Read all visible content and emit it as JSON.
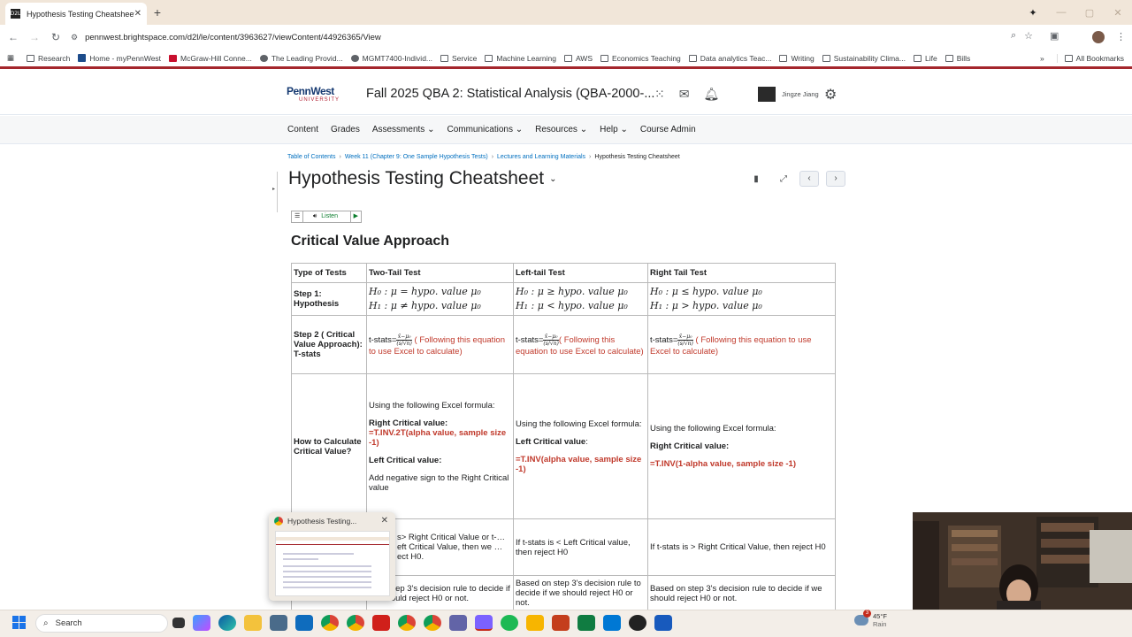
{
  "browser": {
    "tab_title": "Hypothesis Testing Cheatsheet",
    "tab_favicon": "D2L",
    "url": "pennwest.brightspace.com/d2l/le/content/3963627/viewContent/44926365/View",
    "bookmarks": [
      {
        "label": "Research",
        "icon": "folder-icon"
      },
      {
        "label": "Home - myPennWest",
        "icon": "pennwest-icon"
      },
      {
        "label": "McGraw-Hill Conne...",
        "icon": "mcgrawhill-icon"
      },
      {
        "label": "The Leading Provid...",
        "icon": "site-icon"
      },
      {
        "label": "MGMT7400-Individ...",
        "icon": "github-icon"
      },
      {
        "label": "Service",
        "icon": "folder-icon"
      },
      {
        "label": "Machine Learning",
        "icon": "folder-icon"
      },
      {
        "label": "AWS",
        "icon": "folder-icon"
      },
      {
        "label": "Economics Teaching",
        "icon": "folder-icon"
      },
      {
        "label": "Data analytics Teac...",
        "icon": "folder-icon"
      },
      {
        "label": "Writing",
        "icon": "folder-icon"
      },
      {
        "label": "Sustainability Clima...",
        "icon": "folder-icon"
      },
      {
        "label": "Life",
        "icon": "folder-icon"
      },
      {
        "label": "Bills",
        "icon": "folder-icon"
      }
    ],
    "all_bookmarks": "All Bookmarks"
  },
  "header": {
    "logo_main": "PennWest",
    "logo_sub": "UNIVERSITY",
    "course": "Fall 2025 QBA 2: Statistical Analysis (QBA-2000-...",
    "user": "Jingze Jiang"
  },
  "nav": [
    "Content",
    "Grades",
    "Assessments",
    "Communications",
    "Resources",
    "Help",
    "Course Admin"
  ],
  "nav_dropdowns": [
    false,
    false,
    true,
    true,
    true,
    true,
    false
  ],
  "breadcrumbs": [
    "Table of Contents",
    "Week 11 (Chapter 9: One Sample Hypothesis Tests)",
    "Lectures and Learning Materials",
    "Hypothesis Testing Cheatsheet"
  ],
  "page_title": "Hypothesis Testing Cheatsheet",
  "listen": {
    "label": "Listen"
  },
  "section_title": "Critical Value Approach",
  "table": {
    "headers": [
      "Type of Tests",
      "Two-Tail Test",
      "Left-tail Test",
      "Right Tail Test"
    ],
    "step1_label": "Step 1: Hypothesis",
    "h0": [
      "H₀ : μ = hypo. value μ₀",
      "H₀ : μ ≥ hypo. value μ₀",
      "H₀ : μ ≤ hypo. value μ₀"
    ],
    "h1": [
      "H₁ : μ ≠ hypo. value μ₀",
      "H₁ : μ < hypo. value μ₀",
      "H₁ : μ > hypo. value μ₀"
    ],
    "step2_label": "Step 2 ( Critical Value Approach): T-stats",
    "tstat_prefix": "t-stats=",
    "frac_num": "x̄−μ₀",
    "frac_den": "(s/√n)",
    "tstat_note": "( Following this equation to use Excel to calculate)",
    "step3_label": "How to Calculate Critical Value?",
    "excel_intro": "Using the following Excel formula:",
    "right_cv_label": "Right Critical value:",
    "left_cv_label": "Left Critical value:",
    "left_cv_label_b": "Left Critical value",
    "two_tail_right_formula": "=T.INV.2T(alpha value, sample size -1)",
    "two_tail_left_note": "Add negative sign to the Right Critical value",
    "left_tail_formula": "=T.INV(alpha value, sample size -1)",
    "right_tail_formula": "=T.INV(1-alpha value, sample size -1)",
    "rule_two": "s> Right Critical Value or t-…eft Critical Value, then we …ect H0.",
    "rule_left": "If t-stats is < Left Critical value, then reject H0",
    "rule_right": "If t-stats is > Right Critical Value, then reject H0",
    "decide_two": "…on step 3's decision rule to decide if we should reject H0 or not.",
    "decide_left": "Based on step 3's decision rule to decide if we should reject H0 or not.",
    "decide_right": "Based on step 3's decision rule to decide if we should reject H0 or not."
  },
  "popup": {
    "title": "Hypothesis Testing..."
  },
  "taskbar": {
    "search": "Search",
    "weather_temp": "45°F",
    "weather_desc": "Rain",
    "badge": "3"
  }
}
